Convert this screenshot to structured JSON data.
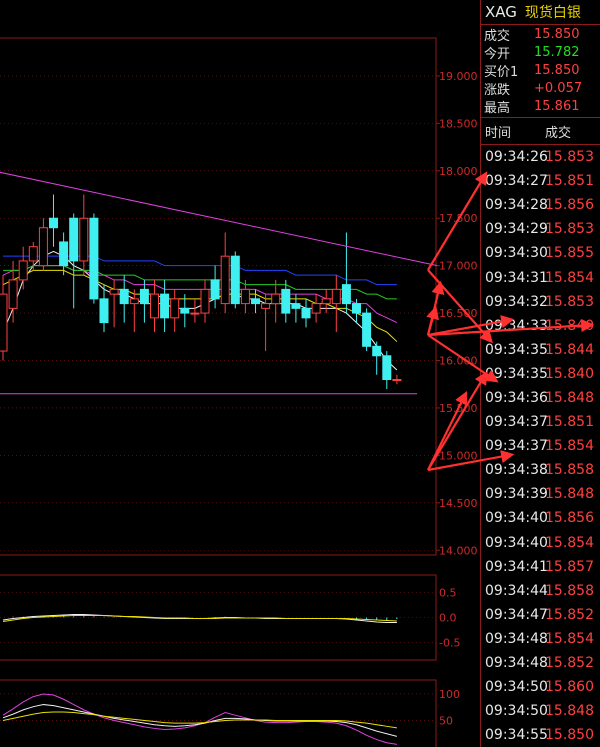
{
  "header": {
    "symbol": "XAG",
    "name": "现货白银"
  },
  "quotes": [
    {
      "label": "成交",
      "value": "15.850",
      "color": "#ff4040"
    },
    {
      "label": "今开",
      "value": "15.782",
      "color": "#22dd22"
    },
    {
      "label": "买价1",
      "value": "15.850",
      "color": "#ff4040"
    },
    {
      "label": "涨跌",
      "value": "+0.057",
      "color": "#ff4040"
    },
    {
      "label": "最高",
      "value": "15.861",
      "color": "#ff4040"
    }
  ],
  "trades_header": {
    "time": "时间",
    "price": "成交"
  },
  "trades": [
    {
      "time": "09:34:26",
      "price": "15.853"
    },
    {
      "time": "09:34:27",
      "price": "15.851"
    },
    {
      "time": "09:34:28",
      "price": "15.856"
    },
    {
      "time": "09:34:29",
      "price": "15.853"
    },
    {
      "time": "09:34:30",
      "price": "15.855"
    },
    {
      "time": "09:34:31",
      "price": "15.854"
    },
    {
      "time": "09:34:32",
      "price": "15.853"
    },
    {
      "time": "09:34:33",
      "price": "15.840"
    },
    {
      "time": "09:34:35",
      "price": "15.844"
    },
    {
      "time": "09:34:35",
      "price": "15.840"
    },
    {
      "time": "09:34:36",
      "price": "15.848"
    },
    {
      "time": "09:34:37",
      "price": "15.851"
    },
    {
      "time": "09:34:37",
      "price": "15.854"
    },
    {
      "time": "09:34:38",
      "price": "15.858"
    },
    {
      "time": "09:34:39",
      "price": "15.848"
    },
    {
      "time": "09:34:40",
      "price": "15.856"
    },
    {
      "time": "09:34:40",
      "price": "15.854"
    },
    {
      "time": "09:34:41",
      "price": "15.857"
    },
    {
      "time": "09:34:44",
      "price": "15.858"
    },
    {
      "time": "09:34:47",
      "price": "15.852"
    },
    {
      "time": "09:34:48",
      "price": "15.854"
    },
    {
      "time": "09:34:48",
      "price": "15.852"
    },
    {
      "time": "09:34:50",
      "price": "15.860"
    },
    {
      "time": "09:34:50",
      "price": "15.848"
    },
    {
      "time": "09:34:55",
      "price": "15.850"
    }
  ],
  "colors": {
    "up": "#ff4040",
    "down": "#40f0f0",
    "grid": "#8b1a1a",
    "axis_text": "#cc2a2a"
  },
  "chart_data": [
    {
      "type": "candlestick",
      "ylim": [
        13.95,
        19.4
      ],
      "y_ticks": [
        "19.000",
        "18.500",
        "18.000",
        "17.500",
        "17.000",
        "16.500",
        "16.000",
        "15.500",
        "15.000",
        "14.500",
        "14.000"
      ],
      "candles": [
        {
          "o": 16.1,
          "c": 16.7,
          "h": 16.9,
          "l": 16.0
        },
        {
          "o": 16.55,
          "c": 16.85,
          "h": 17.05,
          "l": 16.4
        },
        {
          "o": 16.85,
          "c": 17.05,
          "h": 17.2,
          "l": 16.75
        },
        {
          "o": 17.05,
          "c": 17.2,
          "h": 17.25,
          "l": 16.95
        },
        {
          "o": 17.0,
          "c": 17.4,
          "h": 17.5,
          "l": 16.95
        },
        {
          "o": 17.5,
          "c": 17.4,
          "h": 17.75,
          "l": 17.2
        },
        {
          "o": 17.25,
          "c": 17.0,
          "h": 17.35,
          "l": 16.9
        },
        {
          "o": 17.5,
          "c": 17.05,
          "h": 17.55,
          "l": 16.55
        },
        {
          "o": 17.05,
          "c": 17.5,
          "h": 17.75,
          "l": 16.9
        },
        {
          "o": 17.5,
          "c": 16.65,
          "h": 17.55,
          "l": 16.6
        },
        {
          "o": 16.65,
          "c": 16.4,
          "h": 16.8,
          "l": 16.3
        },
        {
          "o": 16.7,
          "c": 16.75,
          "h": 16.85,
          "l": 16.35
        },
        {
          "o": 16.75,
          "c": 16.6,
          "h": 16.9,
          "l": 16.4
        },
        {
          "o": 16.6,
          "c": 16.65,
          "h": 16.75,
          "l": 16.3
        },
        {
          "o": 16.75,
          "c": 16.6,
          "h": 16.85,
          "l": 16.4
        },
        {
          "o": 16.45,
          "c": 16.7,
          "h": 16.85,
          "l": 16.3
        },
        {
          "o": 16.7,
          "c": 16.45,
          "h": 16.85,
          "l": 16.3
        },
        {
          "o": 16.45,
          "c": 16.65,
          "h": 16.75,
          "l": 16.3
        },
        {
          "o": 16.55,
          "c": 16.5,
          "h": 16.7,
          "l": 16.35
        },
        {
          "o": 16.5,
          "c": 16.5,
          "h": 16.65,
          "l": 16.4
        },
        {
          "o": 16.5,
          "c": 16.75,
          "h": 16.85,
          "l": 16.4
        },
        {
          "o": 16.85,
          "c": 16.65,
          "h": 17.0,
          "l": 16.55
        },
        {
          "o": 16.6,
          "c": 17.1,
          "h": 17.35,
          "l": 16.5
        },
        {
          "o": 17.1,
          "c": 16.6,
          "h": 17.15,
          "l": 16.55
        },
        {
          "o": 16.6,
          "c": 16.75,
          "h": 16.85,
          "l": 16.5
        },
        {
          "o": 16.65,
          "c": 16.6,
          "h": 16.75,
          "l": 16.5
        },
        {
          "o": 16.55,
          "c": 16.6,
          "h": 16.7,
          "l": 16.1
        },
        {
          "o": 16.6,
          "c": 16.7,
          "h": 16.85,
          "l": 16.4
        },
        {
          "o": 16.75,
          "c": 16.5,
          "h": 16.85,
          "l": 16.4
        },
        {
          "o": 16.6,
          "c": 16.55,
          "h": 16.7,
          "l": 16.4
        },
        {
          "o": 16.55,
          "c": 16.45,
          "h": 16.65,
          "l": 16.35
        },
        {
          "o": 16.5,
          "c": 16.6,
          "h": 16.7,
          "l": 16.4
        },
        {
          "o": 16.6,
          "c": 16.65,
          "h": 16.75,
          "l": 16.5
        },
        {
          "o": 16.6,
          "c": 16.75,
          "h": 16.9,
          "l": 16.3
        },
        {
          "o": 16.8,
          "c": 16.6,
          "h": 17.35,
          "l": 16.5
        },
        {
          "o": 16.6,
          "c": 16.5,
          "h": 16.65,
          "l": 16.4
        },
        {
          "o": 16.5,
          "c": 16.15,
          "h": 16.55,
          "l": 16.1
        },
        {
          "o": 16.15,
          "c": 16.05,
          "h": 16.2,
          "l": 15.85
        },
        {
          "o": 16.05,
          "c": 15.8,
          "h": 16.1,
          "l": 15.7
        },
        {
          "o": 15.8,
          "c": 15.8,
          "h": 15.85,
          "l": 15.75
        }
      ],
      "ma_lines": [
        {
          "color": "#f0f0f0",
          "values": [
            16.3,
            16.55,
            16.85,
            17.0,
            17.1,
            17.15,
            17.1,
            17.0,
            16.95,
            16.85,
            16.75,
            16.7,
            16.7,
            16.65,
            16.6,
            16.6,
            16.6,
            16.55,
            16.55,
            16.55,
            16.6,
            16.65,
            16.7,
            16.7,
            16.65,
            16.65,
            16.6,
            16.6,
            16.6,
            16.6,
            16.55,
            16.55,
            16.55,
            16.55,
            16.5,
            16.4,
            16.3,
            16.15,
            16.0,
            15.9
          ]
        },
        {
          "color": "#e8e000",
          "values": [
            16.8,
            16.85,
            16.9,
            16.95,
            16.95,
            16.95,
            16.95,
            16.9,
            16.9,
            16.85,
            16.8,
            16.75,
            16.75,
            16.7,
            16.7,
            16.7,
            16.65,
            16.65,
            16.65,
            16.65,
            16.65,
            16.65,
            16.7,
            16.7,
            16.7,
            16.7,
            16.65,
            16.65,
            16.65,
            16.65,
            16.65,
            16.6,
            16.6,
            16.55,
            16.55,
            16.5,
            16.45,
            16.35,
            16.3,
            16.2
          ]
        },
        {
          "color": "#e040e0",
          "values": [
            16.9,
            16.95,
            16.95,
            17.0,
            17.0,
            17.0,
            17.0,
            16.95,
            16.95,
            16.9,
            16.9,
            16.85,
            16.85,
            16.8,
            16.8,
            16.8,
            16.75,
            16.75,
            16.75,
            16.75,
            16.75,
            16.75,
            16.75,
            16.75,
            16.75,
            16.75,
            16.7,
            16.7,
            16.7,
            16.7,
            16.7,
            16.7,
            16.65,
            16.65,
            16.65,
            16.6,
            16.6,
            16.5,
            16.45,
            16.4
          ]
        },
        {
          "color": "#22cc22",
          "values": [
            16.95,
            16.95,
            16.95,
            17.0,
            17.0,
            17.0,
            17.0,
            16.95,
            16.95,
            16.95,
            16.9,
            16.9,
            16.9,
            16.9,
            16.85,
            16.85,
            16.85,
            16.85,
            16.85,
            16.85,
            16.85,
            16.85,
            16.85,
            16.85,
            16.8,
            16.8,
            16.8,
            16.8,
            16.8,
            16.75,
            16.75,
            16.75,
            16.75,
            16.75,
            16.75,
            16.75,
            16.7,
            16.7,
            16.65,
            16.65
          ]
        },
        {
          "color": "#2244ff",
          "values": [
            17.1,
            17.1,
            17.1,
            17.1,
            17.1,
            17.1,
            17.1,
            17.1,
            17.1,
            17.1,
            17.05,
            17.05,
            17.05,
            17.05,
            17.05,
            17.05,
            17.0,
            17.0,
            17.0,
            17.0,
            17.0,
            17.0,
            17.0,
            17.0,
            16.95,
            16.95,
            16.95,
            16.95,
            16.95,
            16.9,
            16.9,
            16.9,
            16.9,
            16.9,
            16.85,
            16.85,
            16.85,
            16.8,
            16.8,
            16.8
          ]
        }
      ],
      "trendlines": [
        {
          "color": "#e040e0",
          "from": {
            "i": -1,
            "y": 18.0
          },
          "to": {
            "i": 43,
            "y": 17.0
          }
        },
        {
          "color": "#e040e0",
          "from": {
            "i": -1,
            "y": 15.65
          },
          "to": {
            "i": 41,
            "y": 15.65
          }
        }
      ]
    },
    {
      "type": "line",
      "ylim": [
        -0.85,
        0.85
      ],
      "y_ticks": [
        "0.5",
        "0.0",
        "-0.5"
      ],
      "series": [
        {
          "color": "#f0f0f0",
          "values": [
            -0.05,
            -0.02,
            0.0,
            0.02,
            0.03,
            0.04,
            0.05,
            0.06,
            0.06,
            0.05,
            0.04,
            0.03,
            0.02,
            0.01,
            0.0,
            -0.01,
            -0.02,
            -0.02,
            -0.02,
            -0.02,
            -0.02,
            -0.01,
            0.0,
            0.0,
            -0.01,
            -0.01,
            -0.02,
            -0.02,
            -0.02,
            -0.02,
            -0.02,
            -0.02,
            -0.02,
            -0.02,
            -0.03,
            -0.05,
            -0.07,
            -0.09,
            -0.1,
            -0.1
          ]
        },
        {
          "color": "#e8e000",
          "values": [
            -0.08,
            -0.05,
            -0.02,
            0.0,
            0.01,
            0.02,
            0.03,
            0.04,
            0.04,
            0.04,
            0.04,
            0.03,
            0.02,
            0.02,
            0.01,
            0.0,
            -0.01,
            -0.01,
            -0.01,
            -0.02,
            -0.02,
            -0.02,
            -0.01,
            -0.01,
            -0.01,
            -0.01,
            -0.01,
            -0.01,
            -0.02,
            -0.02,
            -0.02,
            -0.02,
            -0.02,
            -0.02,
            -0.02,
            -0.03,
            -0.04,
            -0.05,
            -0.06,
            -0.07
          ]
        }
      ],
      "bars": [
        0.0,
        0.02,
        0.02,
        0.03,
        0.04,
        0.05,
        0.05,
        0.05,
        0.04,
        0.04,
        0.02,
        0.02,
        0.0,
        0.0,
        -0.01,
        -0.01,
        0.0,
        0.0,
        0.0,
        0.0,
        0.0,
        0.01,
        0.02,
        0.01,
        0.0,
        0.0,
        0.0,
        0.0,
        0.0,
        0.0,
        0.0,
        0.0,
        0.0,
        0.0,
        0.0,
        -0.02,
        -0.03,
        -0.04,
        -0.05,
        -0.03
      ]
    },
    {
      "type": "line",
      "ylim": [
        0,
        120
      ],
      "y_ticks": [
        "100",
        "50"
      ],
      "series": [
        {
          "color": "#e040e0",
          "values": [
            60,
            72,
            85,
            95,
            100,
            98,
            90,
            80,
            70,
            62,
            55,
            50,
            46,
            42,
            38,
            35,
            33,
            34,
            36,
            40,
            46,
            56,
            65,
            60,
            55,
            50,
            47,
            46,
            46,
            47,
            48,
            48,
            47,
            45,
            40,
            32,
            22,
            14,
            8,
            5
          ]
        },
        {
          "color": "#f0f0f0",
          "values": [
            55,
            62,
            70,
            76,
            80,
            78,
            74,
            70,
            66,
            62,
            58,
            54,
            51,
            48,
            45,
            42,
            40,
            39,
            40,
            42,
            45,
            50,
            54,
            54,
            53,
            51,
            50,
            49,
            49,
            49,
            49,
            49,
            49,
            48,
            46,
            42,
            36,
            30,
            25,
            20
          ]
        },
        {
          "color": "#e8e000",
          "values": [
            50,
            54,
            58,
            62,
            65,
            66,
            66,
            65,
            63,
            61,
            58,
            56,
            54,
            52,
            50,
            48,
            46,
            45,
            45,
            45,
            46,
            48,
            50,
            51,
            51,
            51,
            51,
            50,
            50,
            50,
            50,
            50,
            50,
            50,
            49,
            47,
            45,
            42,
            39,
            36
          ]
        }
      ]
    }
  ],
  "arrows": [
    {
      "from": [
        428,
        470
      ],
      "to": [
        510,
        455
      ]
    },
    {
      "from": [
        428,
        470
      ],
      "to": [
        485,
        375
      ]
    },
    {
      "from": [
        428,
        470
      ],
      "to": [
        465,
        395
      ]
    },
    {
      "from": [
        428,
        270
      ],
      "to": [
        485,
        175
      ]
    },
    {
      "from": [
        428,
        270
      ],
      "to": [
        490,
        340
      ]
    },
    {
      "from": [
        428,
        335
      ],
      "to": [
        510,
        320
      ]
    },
    {
      "from": [
        428,
        335
      ],
      "to": [
        590,
        325
      ]
    },
    {
      "from": [
        428,
        335
      ],
      "to": [
        495,
        380
      ]
    },
    {
      "from": [
        428,
        335
      ],
      "to": [
        435,
        310
      ]
    },
    {
      "from": [
        428,
        335
      ],
      "to": [
        440,
        285
      ]
    }
  ]
}
